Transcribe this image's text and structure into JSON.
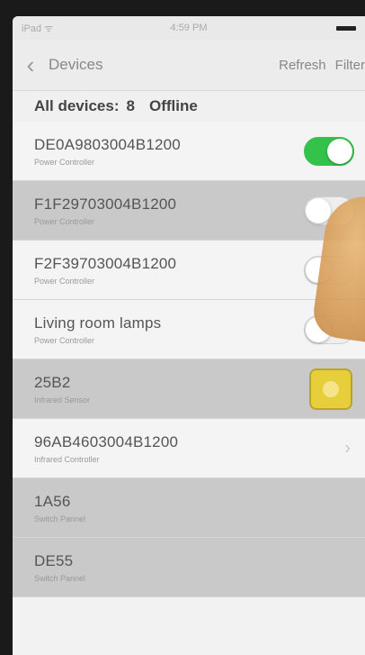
{
  "status_bar": {
    "carrier": "iPad ᯤ",
    "time": "4:59 PM"
  },
  "nav": {
    "back_icon": "chevron-left",
    "title": "Devices",
    "refresh_label": "Refresh",
    "filter_label": "Filter"
  },
  "summary": {
    "label": "All devices:",
    "count": "8",
    "filter": "Offline"
  },
  "devices": [
    {
      "name": "DE0A9803004B1200",
      "type": "Power Controller",
      "control": "toggle",
      "state": "on"
    },
    {
      "name": "F1F29703004B1200",
      "type": "Power Controller",
      "control": "toggle",
      "state": "off"
    },
    {
      "name": "F2F39703004B1200",
      "type": "Power Controller",
      "control": "toggle",
      "state": "off"
    },
    {
      "name": "Living room lamps",
      "type": "Power Controller",
      "control": "toggle",
      "state": "off"
    },
    {
      "name": "25B2",
      "type": "Infrared Sensor",
      "control": "sensor-icon"
    },
    {
      "name": "96AB4603004B1200",
      "type": "Infrared Controller",
      "control": "chevron"
    },
    {
      "name": "1A56",
      "type": "Switch Pannel",
      "control": "none"
    },
    {
      "name": "DE55",
      "type": "Switch Pannel",
      "control": "none"
    }
  ],
  "colors": {
    "toggle_on": "#35c24a",
    "sensor": "#e6cf3a"
  }
}
